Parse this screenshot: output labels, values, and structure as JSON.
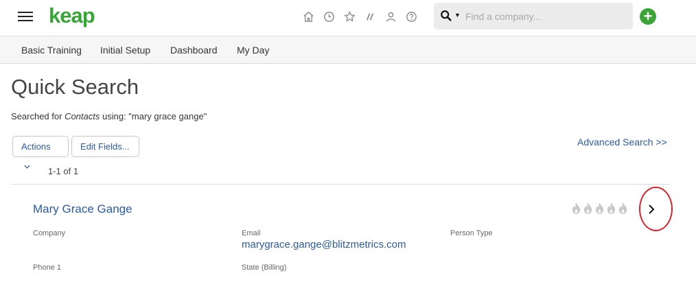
{
  "header": {
    "logo_text": "keap",
    "nav_icons": [
      "home-icon",
      "clock-icon",
      "star-icon",
      "pipeline-icon",
      "person-icon",
      "help-icon"
    ],
    "search": {
      "placeholder": "Find a company..."
    },
    "brand_color": "#36a635",
    "link_color": "#2a5aa6"
  },
  "tabs": [
    {
      "label": "Basic Training"
    },
    {
      "label": "Initial Setup"
    },
    {
      "label": "Dashboard"
    },
    {
      "label": "My Day"
    }
  ],
  "page": {
    "title": "Quick Search",
    "searched_prefix": "Searched for",
    "searched_entity": "Contacts",
    "searched_suffix": "using: \"mary grace gange\"",
    "actions_label": "Actions",
    "edit_fields_label": "Edit Fields...",
    "advanced_search_label": "Advanced Search >>",
    "result_count": "1-1 of 1"
  },
  "result": {
    "name": "Mary Grace Gange",
    "score_flames": 5,
    "fields": {
      "company_label": "Company",
      "email_label": "Email",
      "email_value": "marygrace.gange@blitzmetrics.com",
      "person_type_label": "Person Type",
      "phone_label": "Phone 1",
      "state_label": "State (Billing)"
    }
  }
}
